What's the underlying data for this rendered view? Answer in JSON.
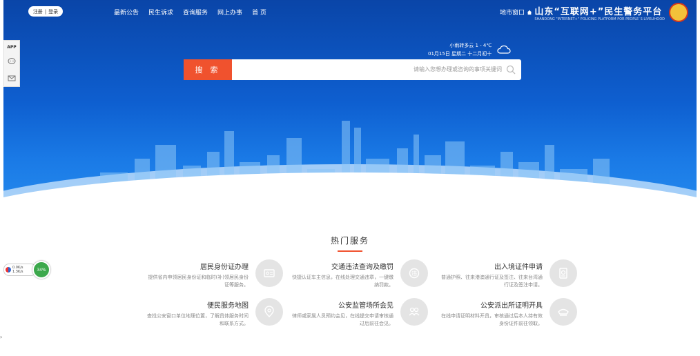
{
  "header": {
    "logo_title": "山东“互联网+”民生警务平台",
    "logo_subtitle": "SHANDONG \"INTERNET+\" POLICING PLATFORM FOR PEOPLE`S LIVELIHOOD",
    "city_entry": "地市窗口",
    "nav": [
      "首 页",
      "网上办事",
      "查询服务",
      "民生诉求",
      "最新公告"
    ],
    "login": "登录",
    "register": "注册"
  },
  "weather": {
    "line1": "小雨转多云 1 - 4℃",
    "line2": "01月15日 星期二 十二月初十"
  },
  "search": {
    "placeholder": "请输入您想办理或咨询的事项关键词",
    "button_label": "搜 索"
  },
  "sidebar": {
    "app_label": "APP"
  },
  "hot_services": {
    "title": "热门服务",
    "items": [
      {
        "title": "出入境证件申请",
        "desc": "普通护照、往来港澳通行证及签注、往来台湾通行证及签注申请。"
      },
      {
        "title": "交通违法查询及缴罚",
        "desc": "快捷认证车主信息，在线处理交通违章，一键缴纳罚款。"
      },
      {
        "title": "居民身份证办理",
        "desc": "提供省内申领居民身份证和临时(补)领居民身份证等服务。"
      },
      {
        "title": "公安派出所证明开具",
        "desc": "在线申请证明材料开具，审核通过后本人持有效身份证件前往领取。"
      },
      {
        "title": "公安监管场所会见",
        "desc": "律师或家属人员预约会见，在线提交申请审核通过后前往会见。"
      },
      {
        "title": "便民服务地图",
        "desc": "查找公安窗口单位地理位置，了解具体服务时间和联系方式。"
      }
    ]
  },
  "badge": {
    "line1": "0.0K/s",
    "line2": "1.3K/s",
    "percent": "34%"
  },
  "colors": {
    "hero_top": "#0a45a8",
    "hero_bottom": "#2a90f0",
    "accent": "#f0522e"
  }
}
